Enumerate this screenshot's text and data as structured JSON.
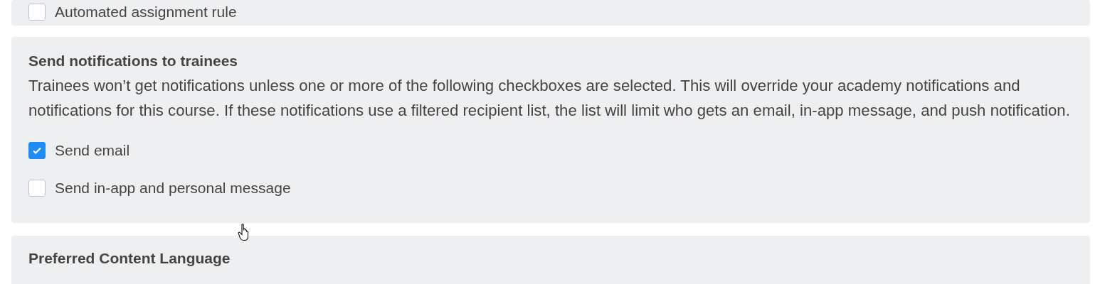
{
  "top_section": {
    "options": [
      {
        "label": "Automated assignment rule",
        "checked": false
      }
    ]
  },
  "notifications": {
    "title": "Send notifications to trainees",
    "description": "Trainees won’t get notifications unless one or more of the following checkboxes are selected. This will override your academy notifications and notifications for this course. If these notifications use a filtered recipient list, the list will limit who gets an email, in-app message, and push notification.",
    "options": [
      {
        "label": "Send email",
        "checked": true
      },
      {
        "label": "Send in-app and personal message",
        "checked": false
      }
    ]
  },
  "next_section": {
    "title": "Preferred Content Language"
  }
}
